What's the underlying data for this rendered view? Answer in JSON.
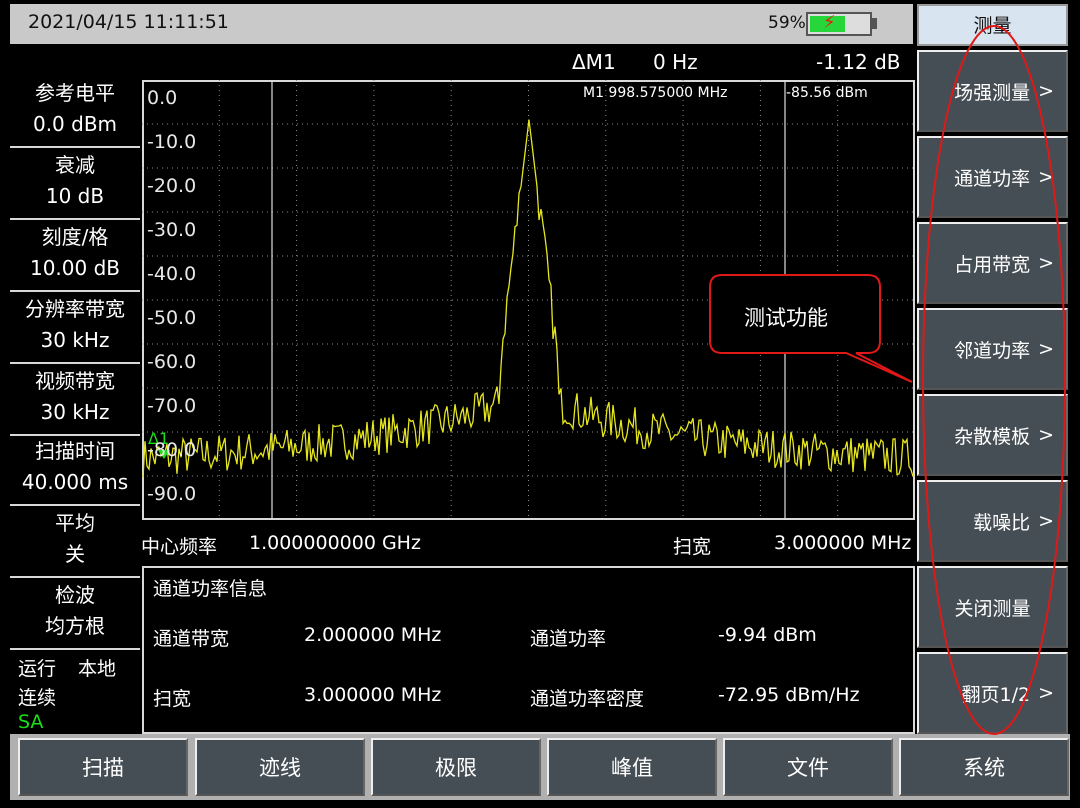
{
  "status_bar": {
    "datetime": "2021/04/15  11:11:51",
    "battery_percent": "59%",
    "battery_level": 0.59
  },
  "left_panel": [
    {
      "label": "参考电平",
      "value": "0.0 dBm"
    },
    {
      "label": "衰减",
      "value": "10 dB"
    },
    {
      "label": "刻度/格",
      "value": "10.00 dB"
    },
    {
      "label": "分辨率带宽",
      "value": "30 kHz"
    },
    {
      "label": "视频带宽",
      "value": "30 kHz"
    },
    {
      "label": "扫描时间",
      "value": "40.000 ms"
    },
    {
      "label": "平均",
      "value": "关"
    },
    {
      "label": "检波",
      "value": "均方根"
    }
  ],
  "status": {
    "run": "运行",
    "local": "本地",
    "continuous": "连续",
    "mode": "SA"
  },
  "marker_header": {
    "delta_marker": "ΔM1",
    "delta_freq": "0 Hz",
    "delta_level": "-1.12  dB"
  },
  "marker_info": {
    "m1": "M1  998.575000 MHz",
    "m1_level": "-85.56 dBm",
    "delta_tag": "Δ1"
  },
  "trace": {
    "y_labels": [
      "0.0",
      "-10.0",
      "-20.0",
      "-30.0",
      "-40.0",
      "-50.0",
      "-60.0",
      "-70.0",
      "-80.0",
      "-90.0"
    ],
    "center_label": "中心频率",
    "center_value": "1.000000000 GHz",
    "span_label": "扫宽",
    "span_value": "3.000000 MHz",
    "trace_color": "#e6e61e"
  },
  "channel_power": {
    "title": "通道功率信息",
    "rows": [
      {
        "k1": "通道带宽",
        "v1": "2.000000 MHz",
        "k2": "通道功率",
        "v2": "-9.94 dBm"
      },
      {
        "k1": "扫宽",
        "v1": "3.000000 MHz",
        "k2": "通道功率密度",
        "v2": "-72.95 dBm/Hz"
      }
    ]
  },
  "annotation": {
    "callout": "测试功能",
    "color": "#e01818"
  },
  "softkeys": {
    "title": "测量",
    "items": [
      {
        "label": "场强测量",
        "arrow": ">"
      },
      {
        "label": "通道功率",
        "arrow": ">"
      },
      {
        "label": "占用带宽",
        "arrow": ">"
      },
      {
        "label": "邻道功率",
        "arrow": ">"
      },
      {
        "label": "杂散模板",
        "arrow": ">"
      },
      {
        "label": "载噪比",
        "arrow": ">"
      },
      {
        "label": "关闭测量",
        "arrow": ""
      },
      {
        "label": "翻页1/2",
        "arrow": ">"
      }
    ]
  },
  "bottom_keys": [
    "扫描",
    "迹线",
    "极限",
    "峰值",
    "文件",
    "系统"
  ]
}
